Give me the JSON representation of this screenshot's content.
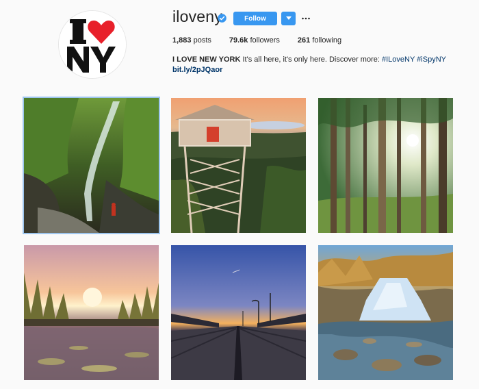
{
  "profile": {
    "username": "iloveny",
    "follow_label": "Follow",
    "stats": {
      "posts_count": "1,883",
      "posts_label": "posts",
      "followers_count": "79.6k",
      "followers_label": "followers",
      "following_count": "261",
      "following_label": "following"
    },
    "bio": {
      "name": "I LOVE NEW YORK",
      "text": "It's all here, it's only here. Discover more:",
      "hashtag1": "#ILoveNY",
      "hashtag2": "#iSpyNY",
      "url": "bit.ly/2pJQaor"
    },
    "avatar_text": "I ♥ NY"
  },
  "colors": {
    "accent": "#3897f0",
    "link": "#003569",
    "background": "#fafafa",
    "heart": "#e8202a"
  },
  "icons": {
    "verified": "verified-badge-icon",
    "dropdown": "chevron-down-icon",
    "more": "more-options-icon"
  },
  "posts": [
    {
      "subject": "waterfall gorge with hiker"
    },
    {
      "subject": "fire tower at sunset over lake"
    },
    {
      "subject": "tall forest trees with sunburst"
    },
    {
      "subject": "sunset over marsh reeds"
    },
    {
      "subject": "boardwalk pier at sunset"
    },
    {
      "subject": "cascading waterfall autumn"
    }
  ]
}
